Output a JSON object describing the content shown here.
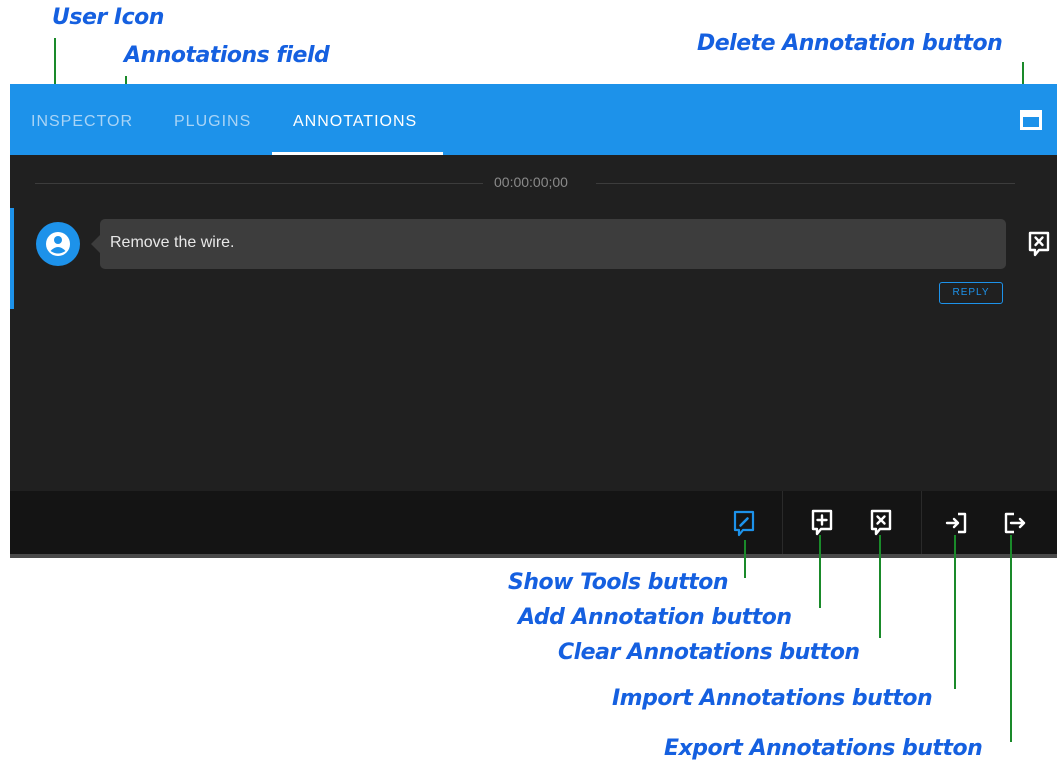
{
  "tabs": [
    {
      "label": "INSPECTOR",
      "active": false
    },
    {
      "label": "PLUGINS",
      "active": false
    },
    {
      "label": "ANNOTATIONS",
      "active": true
    }
  ],
  "timecode": "00:00:00;00",
  "annotation": {
    "text": "Remove the wire.",
    "reply_label": "REPLY"
  },
  "callouts": {
    "user_icon": "User Icon",
    "annotations_field": "Annotations field",
    "delete_annotation": "Delete Annotation button",
    "show_tools": "Show Tools button",
    "add_annotation": "Add Annotation button",
    "clear_annotations": "Clear Annotations button",
    "import_annotations": "Import Annotations button",
    "export_annotations": "Export Annotations button"
  },
  "colors": {
    "accent": "#1d92ea",
    "panel_bg": "#202020",
    "callout_text": "#1560e0",
    "leader_line": "#1a8a2a"
  },
  "icons": {
    "avatar": "user-icon",
    "delete": "delete-annotation-icon",
    "show_tools": "pencil-comment-icon",
    "add": "comment-plus-icon",
    "clear": "comment-x-icon",
    "import": "import-icon",
    "export": "export-icon",
    "expand": "panel-expand-icon"
  }
}
